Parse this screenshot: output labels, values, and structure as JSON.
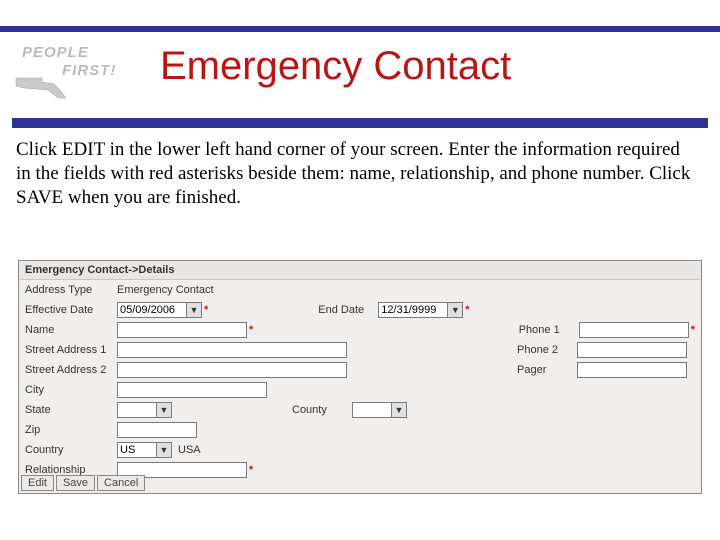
{
  "logo": {
    "line1": "PEOPLE",
    "line2": "FIRST!"
  },
  "title": "Emergency Contact",
  "instructions": "Click EDIT in the lower left hand corner of your screen.  Enter the information required in the fields with red asterisks beside them:  name, relationship, and phone number. Click SAVE when you are finished.",
  "panel": {
    "header": "Emergency Contact->Details",
    "labels": {
      "addressType": "Address Type",
      "effectiveDate": "Effective Date",
      "endDate": "End Date",
      "name": "Name",
      "phone1": "Phone 1",
      "street1": "Street Address 1",
      "phone2": "Phone 2",
      "street2": "Street Address 2",
      "pager": "Pager",
      "city": "City",
      "state": "State",
      "county": "County",
      "zip": "Zip",
      "country": "Country",
      "relationship": "Relationship"
    },
    "values": {
      "addressType": "Emergency Contact",
      "effectiveDate": "05/09/2006",
      "endDate": "12/31/9999",
      "name": "",
      "phone1": "",
      "street1": "",
      "phone2": "",
      "street2": "",
      "pager": "",
      "city": "",
      "state": "",
      "county": "",
      "zip": "",
      "countryCode": "US",
      "countryName": "USA",
      "relationship": ""
    },
    "asterisk": "*",
    "dropdownGlyph": "▼",
    "buttons": {
      "edit": "Edit",
      "save": "Save",
      "cancel": "Cancel"
    }
  }
}
